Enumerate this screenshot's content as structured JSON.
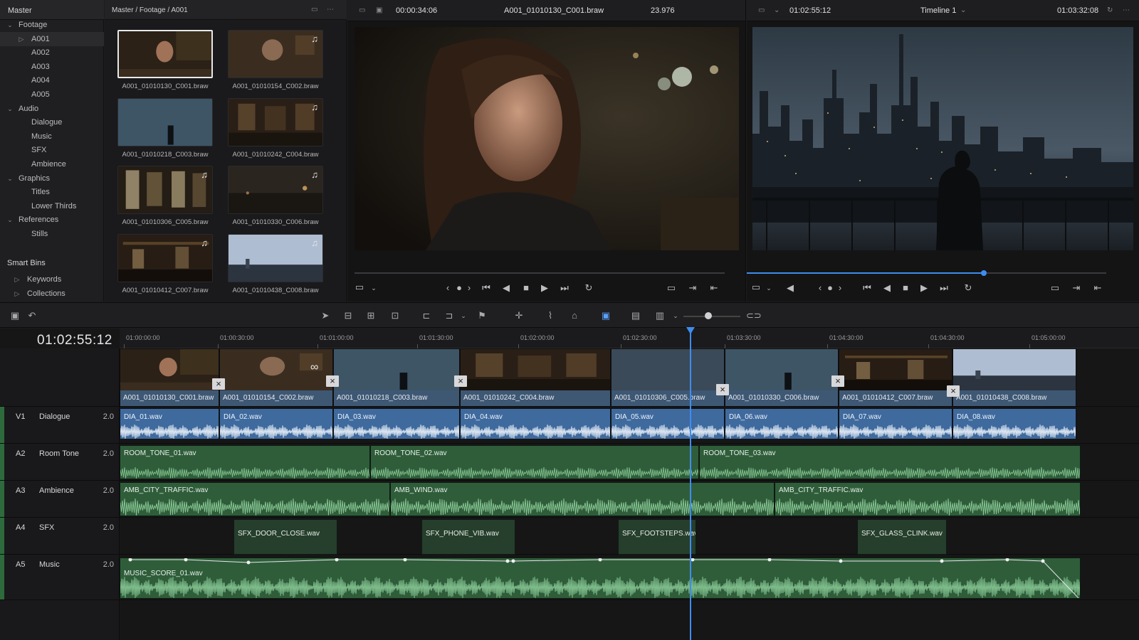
{
  "sidebar": {
    "title": "Master",
    "items": [
      {
        "label": "Footage",
        "chev": "v",
        "indent": 0
      },
      {
        "label": "A001",
        "chev": ">",
        "indent": 2,
        "selected": true
      },
      {
        "label": "A002",
        "chev": "",
        "indent": 2
      },
      {
        "label": "A003",
        "chev": "",
        "indent": 2
      },
      {
        "label": "A004",
        "chev": "",
        "indent": 2
      },
      {
        "label": "A005",
        "chev": "",
        "indent": 2
      },
      {
        "label": "Audio",
        "chev": "v",
        "indent": 0
      },
      {
        "label": "Dialogue",
        "chev": "",
        "indent": 2
      },
      {
        "label": "Music",
        "chev": "",
        "indent": 2
      },
      {
        "label": "SFX",
        "chev": "",
        "indent": 2
      },
      {
        "label": "Ambience",
        "chev": "",
        "indent": 2
      },
      {
        "label": "Graphics",
        "chev": "v",
        "indent": 0
      },
      {
        "label": "Titles",
        "chev": "",
        "indent": 2
      },
      {
        "label": "Lower Thirds",
        "chev": "",
        "indent": 2
      },
      {
        "label": "References",
        "chev": "v",
        "indent": 0
      },
      {
        "label": "Stills",
        "chev": "",
        "indent": 2
      }
    ],
    "smart_bins_title": "Smart Bins",
    "smart_bins": [
      {
        "label": "Keywords",
        "chev": ">"
      },
      {
        "label": "Collections",
        "chev": ">"
      }
    ]
  },
  "pool": {
    "path": "Master / Footage / A001",
    "clips": [
      {
        "name": "A001_01010130_C001.braw",
        "scene": "woman",
        "audio": false,
        "selected": true
      },
      {
        "name": "A001_01010154_C002.braw",
        "scene": "man",
        "audio": true
      },
      {
        "name": "A001_01010218_C003.braw",
        "scene": "city",
        "audio": false
      },
      {
        "name": "A001_01010242_C004.braw",
        "scene": "bar",
        "audio": true
      },
      {
        "name": "A001_01010306_C005.braw",
        "scene": "interior",
        "audio": true
      },
      {
        "name": "A001_01010330_C006.braw",
        "scene": "silhouette",
        "audio": true
      },
      {
        "name": "A001_01010412_C007.braw",
        "scene": "bar2",
        "audio": true
      },
      {
        "name": "A001_01010438_C008.braw",
        "scene": "sky",
        "audio": true
      }
    ]
  },
  "source_viewer": {
    "timecode": "00:00:34:06",
    "clip_name": "A001_01010130_C001.braw",
    "fps": "23.976"
  },
  "timeline_viewer": {
    "timecode": "01:02:55:12",
    "timeline_name": "Timeline 1",
    "duration": "01:03:32:08",
    "scrub_position": 0.66
  },
  "timeline": {
    "current_timecode": "01:02:55:12",
    "ruler": [
      "01:00:00:00",
      "01:00:30:00",
      "01:01:00:00",
      "01:01:30:00",
      "01:02:00:00",
      "01:02:30:00",
      "01:03:30:00",
      "01:04:30:00",
      "01:04:30:00",
      "01:05:00:00"
    ],
    "tracks": [
      {
        "id": "V1",
        "name": "Dialogue",
        "vol": "2.0"
      },
      {
        "id": "A2",
        "name": "Room Tone",
        "vol": "2.0"
      },
      {
        "id": "A3",
        "name": "Ambience",
        "vol": "2.0"
      },
      {
        "id": "A4",
        "name": "SFX",
        "vol": "2.0"
      },
      {
        "id": "A5",
        "name": "Music",
        "vol": "2.0"
      }
    ],
    "video_clips": [
      {
        "name": "A001_01010130_C001.braw",
        "scene": "woman"
      },
      {
        "name": "A001_01010154_C002.braw",
        "scene": "man"
      },
      {
        "name": "A001_01010218_C003.braw",
        "scene": "city"
      },
      {
        "name": "A001_01010242_C004.braw",
        "scene": "bar"
      },
      {
        "name": "A001_01010306_C005.braw",
        "scene": "city2"
      },
      {
        "name": "A001_01010330_C006.braw",
        "scene": "city"
      },
      {
        "name": "A001_01010412_C007.braw",
        "scene": "bar2"
      },
      {
        "name": "A001_01010438_C008.braw",
        "scene": "sky"
      }
    ],
    "dialogue_clips": [
      "DIA_01.wav",
      "DIA_02.wav",
      "DIA_03.wav",
      "DIA_04.wav",
      "DIA_05.wav",
      "DIA_06.wav",
      "DIA_07.wav",
      "DIA_08.wav"
    ],
    "room_tone_clips": [
      "ROOM_TONE_01.wav",
      "ROOM_TONE_02.wav",
      "ROOM_TONE_03.wav"
    ],
    "ambience_clips": [
      "AMB_CITY_TRAFFIC.wav",
      "AMB_WIND.wav",
      "AMB_CITY_TRAFFIC.wav"
    ],
    "sfx_clips": [
      "SFX_DOOR_CLOSE.wav",
      "SFX_PHONE_VIB.wav",
      "SFX_FOOTSTEPS.wav",
      "SFX_GLASS_CLINK.wav"
    ],
    "music_clips": [
      "MUSIC_SCORE_01.wav"
    ]
  },
  "colors": {
    "accent": "#3f8cf0",
    "video_clip": "#3e5874",
    "dialogue_clip": "#3f6a9e",
    "audio_clip": "#2f5d3a"
  }
}
